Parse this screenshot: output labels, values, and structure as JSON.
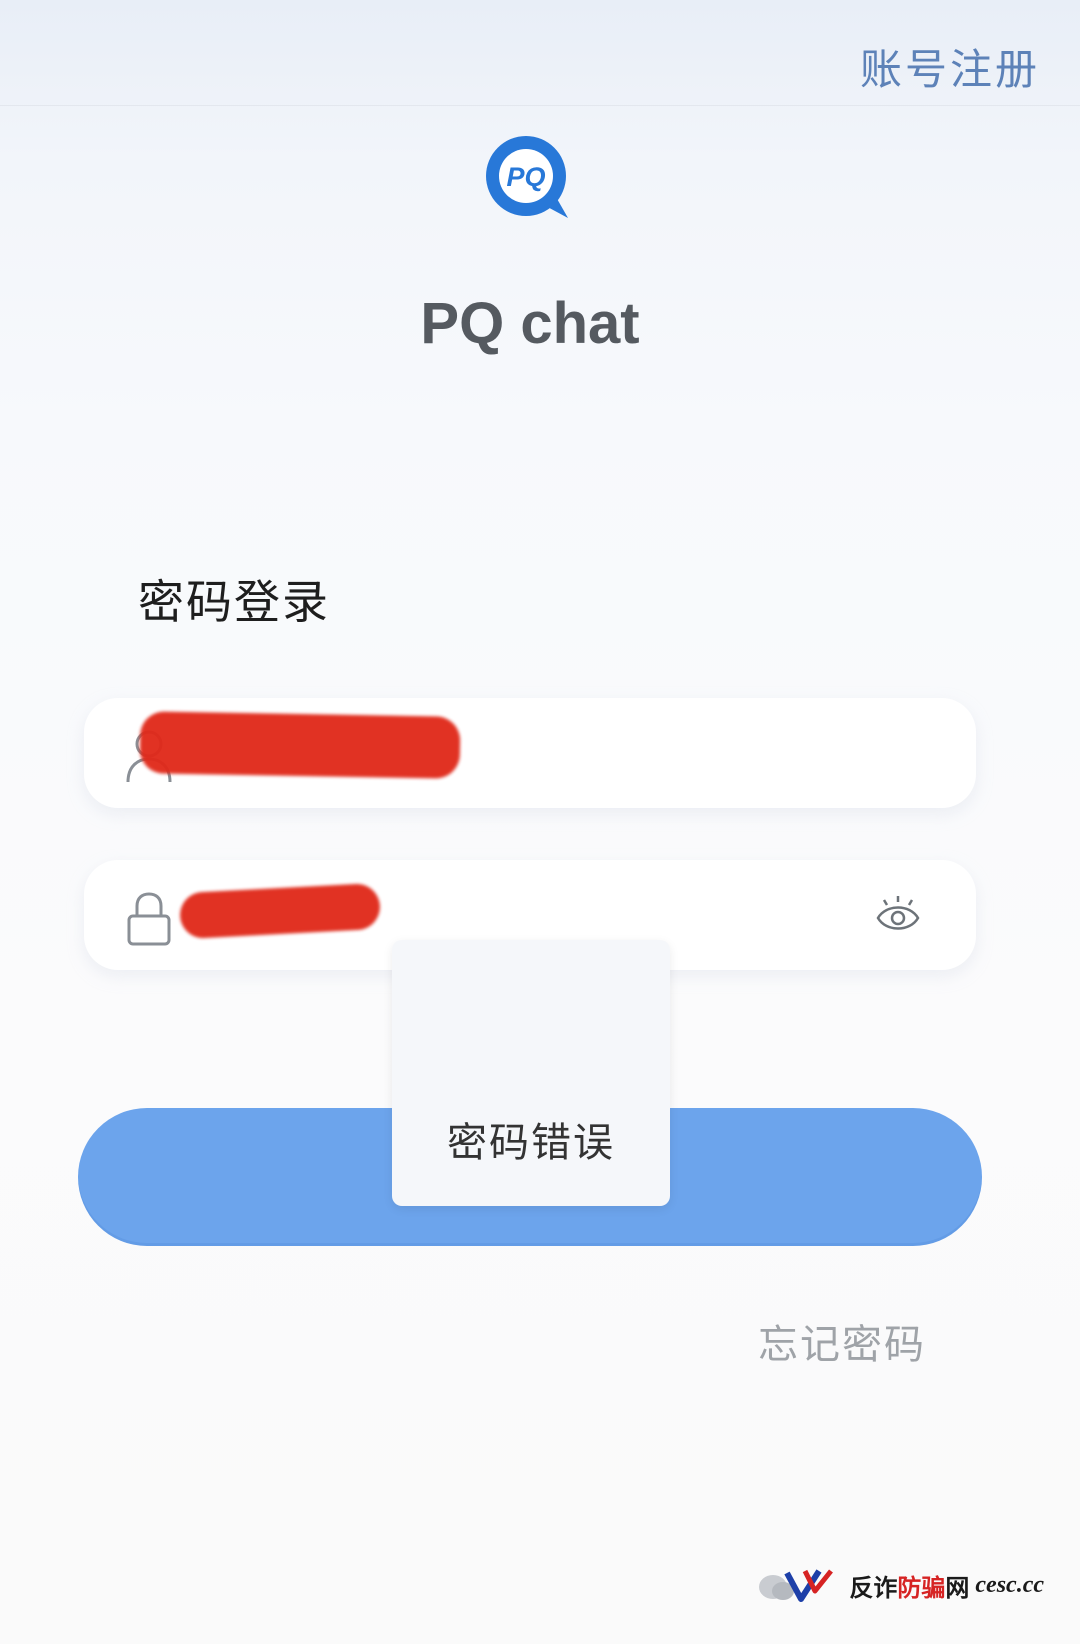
{
  "header": {
    "register_label": "账号注册"
  },
  "app": {
    "name": "PQ chat",
    "logo_text": "PQ",
    "brand_color": "#2878d8"
  },
  "login": {
    "title": "密码登录",
    "username_icon": "user-icon",
    "password_icon": "lock-icon",
    "visibility_icon": "eye-icon"
  },
  "toast": {
    "message": "密码错误"
  },
  "links": {
    "forgot_password": "忘记密码"
  },
  "watermark": {
    "part1": "反诈",
    "part2": "防骗",
    "part3": "网",
    "domain": "cesc.cc"
  },
  "colors": {
    "accent_button": "#6ca4ec",
    "link": "#5d82b8",
    "redaction": "#e02a1b"
  }
}
